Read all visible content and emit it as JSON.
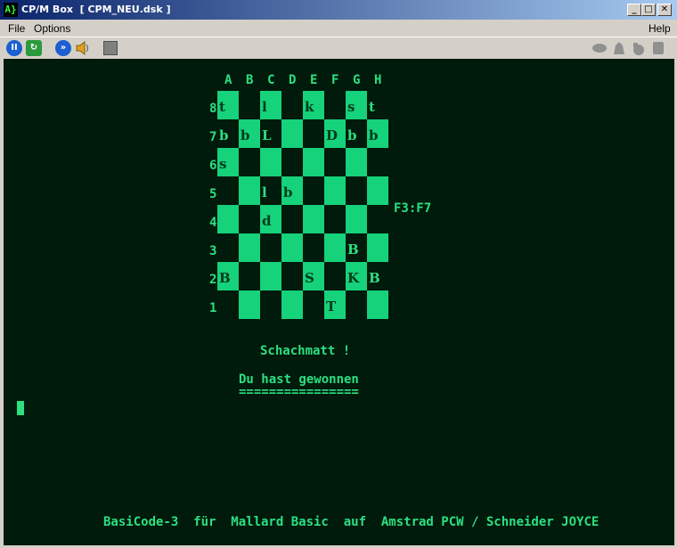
{
  "window": {
    "app_icon": "A}",
    "title": "CP/M Box  [ CPM_NEU.dsk ]",
    "buttons": {
      "minimize": "_",
      "maximize": "□",
      "close": "✕"
    }
  },
  "menu": {
    "file": "File",
    "options": "Options",
    "help": "Help"
  },
  "toolbar": {
    "icons": [
      "pause-icon",
      "reset-icon",
      "fast-forward-icon",
      "sound-icon",
      "stop-icon"
    ],
    "status_icons": [
      "drive-icon",
      "mouse-icon",
      "joystick-icon",
      "disk-icon"
    ]
  },
  "board": {
    "files": [
      "A",
      "B",
      "C",
      "D",
      "E",
      "F",
      "G",
      "H"
    ],
    "ranks": [
      "8",
      "7",
      "6",
      "5",
      "4",
      "3",
      "2",
      "1"
    ],
    "pieces": [
      {
        "sq": "A8",
        "p": "t"
      },
      {
        "sq": "C8",
        "p": "l"
      },
      {
        "sq": "E8",
        "p": "k"
      },
      {
        "sq": "G8",
        "p": "s"
      },
      {
        "sq": "H8",
        "p": "t"
      },
      {
        "sq": "A7",
        "p": "b"
      },
      {
        "sq": "B7",
        "p": "b"
      },
      {
        "sq": "C7",
        "p": "L"
      },
      {
        "sq": "F7",
        "p": "D"
      },
      {
        "sq": "G7",
        "p": "b"
      },
      {
        "sq": "H7",
        "p": "b"
      },
      {
        "sq": "A6",
        "p": "s"
      },
      {
        "sq": "C5",
        "p": "l"
      },
      {
        "sq": "D5",
        "p": "b"
      },
      {
        "sq": "C4",
        "p": "d"
      },
      {
        "sq": "G3",
        "p": "B"
      },
      {
        "sq": "A2",
        "p": "B"
      },
      {
        "sq": "E2",
        "p": "S"
      },
      {
        "sq": "G2",
        "p": "K"
      },
      {
        "sq": "H2",
        "p": "B"
      },
      {
        "sq": "F1",
        "p": "T"
      }
    ]
  },
  "screen": {
    "last_move": "F3:F7",
    "message": "Schachmatt !",
    "result": "Du hast gewonnen",
    "underline": "================",
    "footer": "BasiCode-3  für  Mallard Basic  auf  Amstrad PCW / Schneider JOYCE"
  },
  "colors": {
    "screen_bg": "#001a0c",
    "phosphor": "#2be080",
    "square": "#16d27a"
  }
}
